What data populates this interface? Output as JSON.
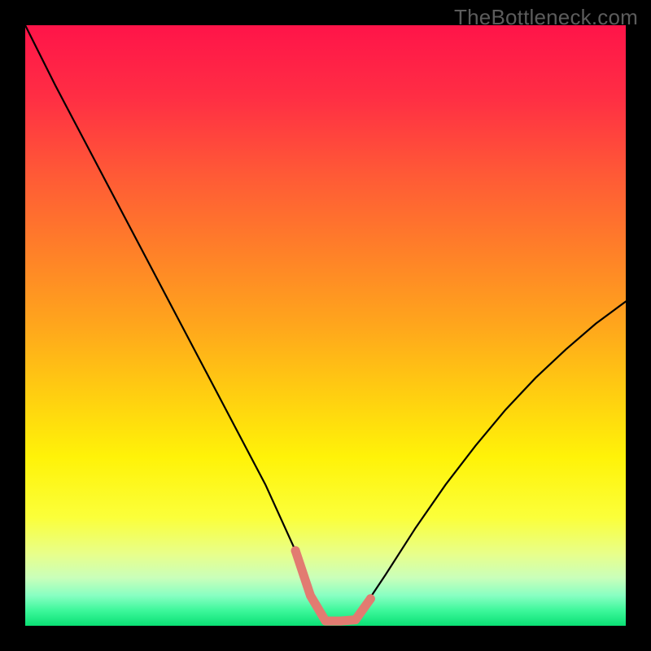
{
  "watermark": "TheBottleneck.com",
  "chart_data": {
    "type": "line",
    "title": "",
    "xlabel": "",
    "ylabel": "",
    "xlim": [
      0,
      100
    ],
    "ylim": [
      0,
      100
    ],
    "background": {
      "type": "vertical-gradient",
      "stops": [
        {
          "offset": 0.0,
          "color": "#ff1449"
        },
        {
          "offset": 0.12,
          "color": "#ff2e44"
        },
        {
          "offset": 0.25,
          "color": "#ff5a36"
        },
        {
          "offset": 0.38,
          "color": "#ff8128"
        },
        {
          "offset": 0.5,
          "color": "#ffa61c"
        },
        {
          "offset": 0.62,
          "color": "#ffd010"
        },
        {
          "offset": 0.72,
          "color": "#fff308"
        },
        {
          "offset": 0.82,
          "color": "#fbff3a"
        },
        {
          "offset": 0.88,
          "color": "#e8ff8a"
        },
        {
          "offset": 0.92,
          "color": "#caffba"
        },
        {
          "offset": 0.95,
          "color": "#87ffc2"
        },
        {
          "offset": 0.975,
          "color": "#3cf79a"
        },
        {
          "offset": 1.0,
          "color": "#0ae074"
        }
      ]
    },
    "series": [
      {
        "name": "bottleneck-curve",
        "stroke": "#000000",
        "stroke_width": 2.2,
        "x": [
          0,
          5,
          10,
          15,
          20,
          25,
          30,
          35,
          40,
          45,
          47.5,
          50,
          52.5,
          55,
          60,
          65,
          70,
          75,
          80,
          85,
          90,
          95,
          100
        ],
        "y": [
          100,
          90,
          80.5,
          71,
          61.5,
          52,
          42.5,
          33,
          23.5,
          12.5,
          5,
          0.8,
          0.8,
          1.0,
          8.5,
          16.3,
          23.5,
          30,
          36,
          41.3,
          46,
          50.3,
          54
        ]
      }
    ],
    "marker_band": {
      "name": "optimal-zone",
      "color": "#e27b71",
      "stroke_width": 11,
      "dot_radius": 5.5,
      "x": [
        45,
        47.5,
        50,
        52.5,
        55,
        57.5
      ],
      "y": [
        12.5,
        5,
        0.8,
        0.8,
        1.0,
        4.5
      ]
    }
  }
}
